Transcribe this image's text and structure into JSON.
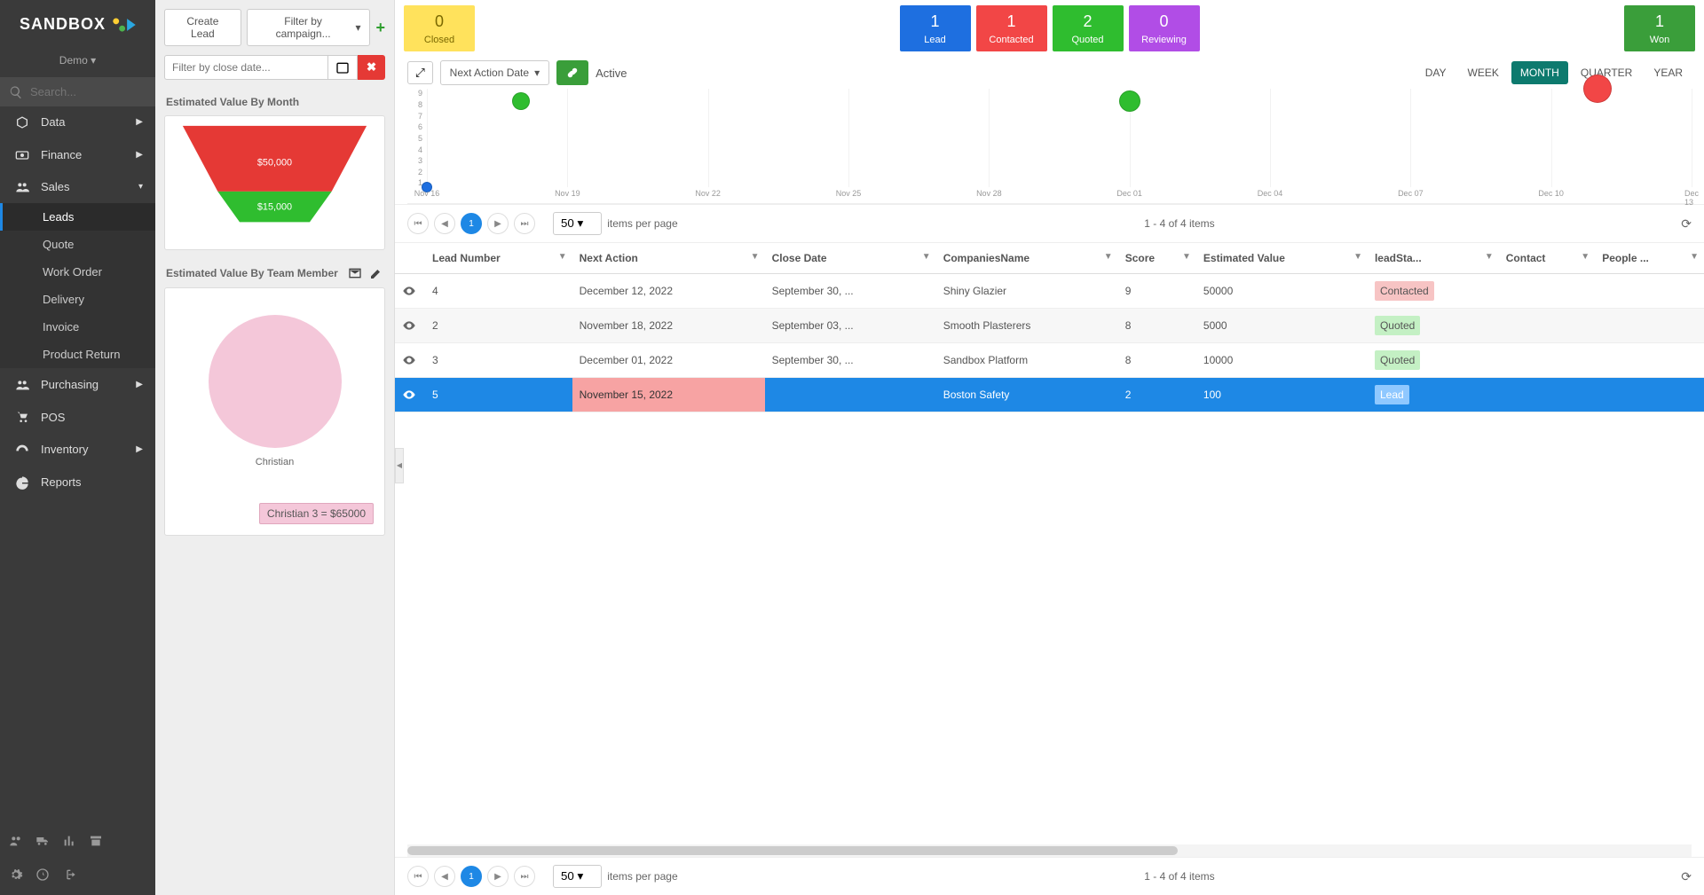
{
  "brand": "SANDBOX",
  "tenant": "Demo",
  "search_placeholder": "Search...",
  "nav": {
    "data": "Data",
    "finance": "Finance",
    "sales": "Sales",
    "purchasing": "Purchasing",
    "pos": "POS",
    "inventory": "Inventory",
    "reports": "Reports",
    "sub": {
      "leads": "Leads",
      "quote": "Quote",
      "work_order": "Work Order",
      "delivery": "Delivery",
      "invoice": "Invoice",
      "product_return": "Product Return"
    }
  },
  "panel": {
    "create_lead": "Create Lead",
    "filter_campaign": "Filter by campaign...",
    "filter_close_placeholder": "Filter by close date...",
    "card1_title": "Estimated Value By Month",
    "funnel_mid": "$50,000",
    "funnel_bot": "$15,000",
    "card2_title": "Estimated Value By Team Member",
    "pie_label": "Christian",
    "tooltip": "Christian 3 = $65000"
  },
  "status": {
    "closed": {
      "n": "0",
      "l": "Closed"
    },
    "lead": {
      "n": "1",
      "l": "Lead"
    },
    "contacted": {
      "n": "1",
      "l": "Contacted"
    },
    "quoted": {
      "n": "2",
      "l": "Quoted"
    },
    "reviewing": {
      "n": "0",
      "l": "Reviewing"
    },
    "won": {
      "n": "1",
      "l": "Won"
    }
  },
  "chart": {
    "dropdown": "Next Action Date",
    "active": "Active",
    "tabs": {
      "day": "DAY",
      "week": "WEEK",
      "month": "MONTH",
      "quarter": "QUARTER",
      "year": "YEAR"
    }
  },
  "chart_data": {
    "type": "scatter",
    "xticks": [
      "Nov 16",
      "Nov 19",
      "Nov 22",
      "Nov 25",
      "Nov 28",
      "Dec 01",
      "Dec 04",
      "Dec 07",
      "Dec 10",
      "Dec 13"
    ],
    "yticks": [
      "1",
      "2",
      "3",
      "4",
      "5",
      "6",
      "7",
      "8",
      "9"
    ],
    "points": [
      {
        "x": "Nov 16",
        "y": 1,
        "r": 6,
        "color": "#1e6fe0"
      },
      {
        "x": "Nov 18",
        "y": 8,
        "r": 10,
        "color": "#2fbd2f"
      },
      {
        "x": "Dec 01",
        "y": 8,
        "r": 12,
        "color": "#2fbd2f"
      },
      {
        "x": "Dec 11",
        "y": 9,
        "r": 16,
        "color": "#f24646"
      }
    ]
  },
  "pager": {
    "page": "1",
    "size": "50",
    "per_page": "items per page",
    "range": "1 - 4 of 4 items"
  },
  "columns": {
    "lead_number": "Lead Number",
    "next_action": "Next Action",
    "close_date": "Close Date",
    "companies": "CompaniesName",
    "score": "Score",
    "est_value": "Estimated Value",
    "lead_status": "leadSta...",
    "contact": "Contact",
    "people": "People ..."
  },
  "rows": [
    {
      "num": "4",
      "next": "December 12, 2022",
      "close": "September 30, ...",
      "company": "Shiny Glazier",
      "score": "9",
      "value": "50000",
      "status": "Contacted",
      "status_cls": "contacted"
    },
    {
      "num": "2",
      "next": "November 18, 2022",
      "close": "September 03, ...",
      "company": "Smooth Plasterers",
      "score": "8",
      "value": "5000",
      "status": "Quoted",
      "status_cls": "quoted"
    },
    {
      "num": "3",
      "next": "December 01, 2022",
      "close": "September 30, ...",
      "company": "Sandbox Platform",
      "score": "8",
      "value": "10000",
      "status": "Quoted",
      "status_cls": "quoted"
    },
    {
      "num": "5",
      "next": "November 15, 2022",
      "close": "",
      "company": "Boston Safety",
      "score": "2",
      "value": "100",
      "status": "Lead",
      "status_cls": "lead"
    }
  ]
}
